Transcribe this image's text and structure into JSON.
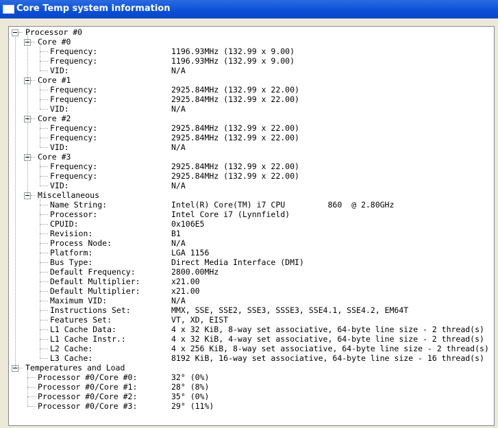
{
  "window": {
    "title": "Core Temp system information"
  },
  "tree": [
    {
      "label": "Processor #0",
      "children": [
        {
          "label": "Core #0",
          "children": [
            {
              "label": "Frequency:",
              "value": "1196.93MHz (132.99 x 9.00)"
            },
            {
              "label": "Frequency:",
              "value": "1196.93MHz (132.99 x 9.00)"
            },
            {
              "label": "VID:",
              "value": "N/A"
            }
          ]
        },
        {
          "label": "Core #1",
          "children": [
            {
              "label": "Frequency:",
              "value": "2925.84MHz (132.99 x 22.00)"
            },
            {
              "label": "Frequency:",
              "value": "2925.84MHz (132.99 x 22.00)"
            },
            {
              "label": "VID:",
              "value": "N/A"
            }
          ]
        },
        {
          "label": "Core #2",
          "children": [
            {
              "label": "Frequency:",
              "value": "2925.84MHz (132.99 x 22.00)"
            },
            {
              "label": "Frequency:",
              "value": "2925.84MHz (132.99 x 22.00)"
            },
            {
              "label": "VID:",
              "value": "N/A"
            }
          ]
        },
        {
          "label": "Core #3",
          "children": [
            {
              "label": "Frequency:",
              "value": "2925.84MHz (132.99 x 22.00)"
            },
            {
              "label": "Frequency:",
              "value": "2925.84MHz (132.99 x 22.00)"
            },
            {
              "label": "VID:",
              "value": "N/A"
            }
          ]
        },
        {
          "label": "Miscellaneous",
          "children": [
            {
              "label": "Name String:",
              "value": "Intel(R) Core(TM) i7 CPU         860  @ 2.80GHz"
            },
            {
              "label": "Processor:",
              "value": "Intel Core i7 (Lynnfield)"
            },
            {
              "label": "CPUID:",
              "value": "0x106E5"
            },
            {
              "label": "Revision:",
              "value": "B1"
            },
            {
              "label": "Process Node:",
              "value": "N/A"
            },
            {
              "label": "Platform:",
              "value": "LGA 1156"
            },
            {
              "label": "Bus Type:",
              "value": "Direct Media Interface (DMI)"
            },
            {
              "label": "Default Frequency:",
              "value": "2800.00MHz"
            },
            {
              "label": "Default Multiplier:",
              "value": "x21.00"
            },
            {
              "label": "Default Multiplier:",
              "value": "x21.00"
            },
            {
              "label": "Maximum VID:",
              "value": "N/A"
            },
            {
              "label": "Instructions Set:",
              "value": "MMX, SSE, SSE2, SSE3, SSSE3, SSE4.1, SSE4.2, EM64T"
            },
            {
              "label": "Features Set:",
              "value": "VT, XD, EIST"
            },
            {
              "label": "L1 Cache Data:",
              "value": "4 x 32 KiB, 8-way set associative, 64-byte line size - 2 thread(s)"
            },
            {
              "label": "L1 Cache Instr.:",
              "value": "4 x 32 KiB, 4-way set associative, 64-byte line size - 2 thread(s)"
            },
            {
              "label": "L2 Cache:",
              "value": "4 x 256 KiB, 8-way set associative, 64-byte line size - 2 thread(s)"
            },
            {
              "label": "L3 Cache:",
              "value": "8192 KiB, 16-way set associative, 64-byte line size - 16 thread(s)"
            }
          ]
        }
      ]
    },
    {
      "label": "Temperatures and Load",
      "children": [
        {
          "label": "Processor #0/Core #0:",
          "value": "32° (0%)"
        },
        {
          "label": "Processor #0/Core #1:",
          "value": "28° (8%)"
        },
        {
          "label": "Processor #0/Core #2:",
          "value": "35° (0%)"
        },
        {
          "label": "Processor #0/Core #3:",
          "value": "29° (11%)"
        }
      ]
    }
  ]
}
